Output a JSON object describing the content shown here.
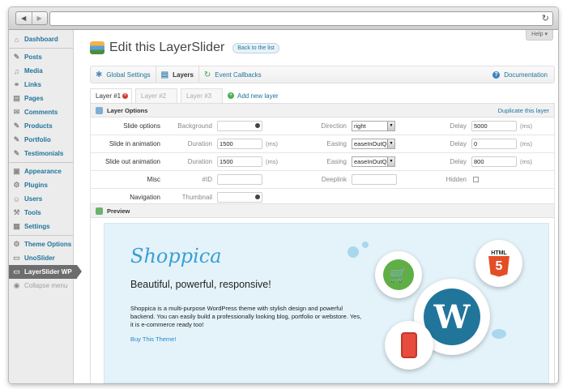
{
  "browser": {
    "back_icon": "◀",
    "forward_icon": "▶",
    "reload_icon": "↻"
  },
  "sidebar": {
    "items": [
      {
        "label": "Dashboard",
        "icon": "⌂"
      },
      {
        "label": "Posts",
        "icon": "✎"
      },
      {
        "label": "Media",
        "icon": "♫"
      },
      {
        "label": "Links",
        "icon": "⚭"
      },
      {
        "label": "Pages",
        "icon": "▤"
      },
      {
        "label": "Comments",
        "icon": "✉"
      },
      {
        "label": "Products",
        "icon": "✎"
      },
      {
        "label": "Portfolio",
        "icon": "✎"
      },
      {
        "label": "Testimonials",
        "icon": "✎"
      },
      {
        "label": "Appearance",
        "icon": "▣"
      },
      {
        "label": "Plugins",
        "icon": "⚙"
      },
      {
        "label": "Users",
        "icon": "☺"
      },
      {
        "label": "Tools",
        "icon": "⚒"
      },
      {
        "label": "Settings",
        "icon": "▦"
      },
      {
        "label": "Theme Options",
        "icon": "⚙"
      },
      {
        "label": "UnoSlider",
        "icon": "▭"
      },
      {
        "label": "LayerSlider WP",
        "icon": "▭"
      },
      {
        "label": "Collapse menu",
        "icon": "◉"
      }
    ]
  },
  "header": {
    "help": "Help ▾",
    "title": "Edit this LayerSlider",
    "back": "Back to the list"
  },
  "toolbar": {
    "global": "Global Settings",
    "layers": "Layers",
    "events": "Event Callbacks",
    "docs": "Documentation",
    "docs_icon": "?"
  },
  "layer_tabs": {
    "tabs": [
      "Layer #1",
      "Layer #2",
      "Layer #3"
    ],
    "remove_icon": "×",
    "add": "Add new layer",
    "add_icon": "+"
  },
  "layer_options": {
    "title": "Layer Options",
    "duplicate": "Duplicate this layer",
    "rows": {
      "slide_options": {
        "label": "Slide options",
        "background": "Background",
        "direction_label": "Direction",
        "direction": "right",
        "delay_label": "Delay",
        "delay": "5000",
        "unit": "(ms)"
      },
      "slide_in": {
        "label": "Slide in animation",
        "duration_label": "Duration",
        "duration": "1500",
        "unit": "(ms)",
        "easing_label": "Easing",
        "easing": "easeInOutQuint",
        "delay_label": "Delay",
        "delay": "0"
      },
      "slide_out": {
        "label": "Slide out animation",
        "duration_label": "Duration",
        "duration": "1500",
        "unit": "(ms)",
        "easing_label": "Easing",
        "easing": "easeInOutQuint",
        "delay_label": "Delay",
        "delay": "800"
      },
      "misc": {
        "label": "Misc",
        "id_label": "#ID",
        "deeplink_label": "Deeplink",
        "hidden_label": "Hidden"
      },
      "navigation": {
        "label": "Navigation",
        "thumbnail_label": "Thumbnail"
      }
    }
  },
  "preview": {
    "title": "Preview",
    "brand": "Shoppica",
    "tagline": "Beautiful, powerful, responsive!",
    "description": "Shoppica is a multi-purpose WordPress theme with stylish design and powerful backend. You can easily build a professionally looking blog, portfolio or webstore. Yes, it is e-commerce ready too!",
    "cta": "Buy This Theme!",
    "html5_top": "HTML",
    "html5_num": "5",
    "wp_letter": "W",
    "cart_icon": "🛒",
    "phone_icon": "▯"
  },
  "colors": {
    "accent": "#21759b",
    "active_menu": "#6d6d6d",
    "slide_bg": "#e4f3fa",
    "brand": "#3a9fd4"
  }
}
